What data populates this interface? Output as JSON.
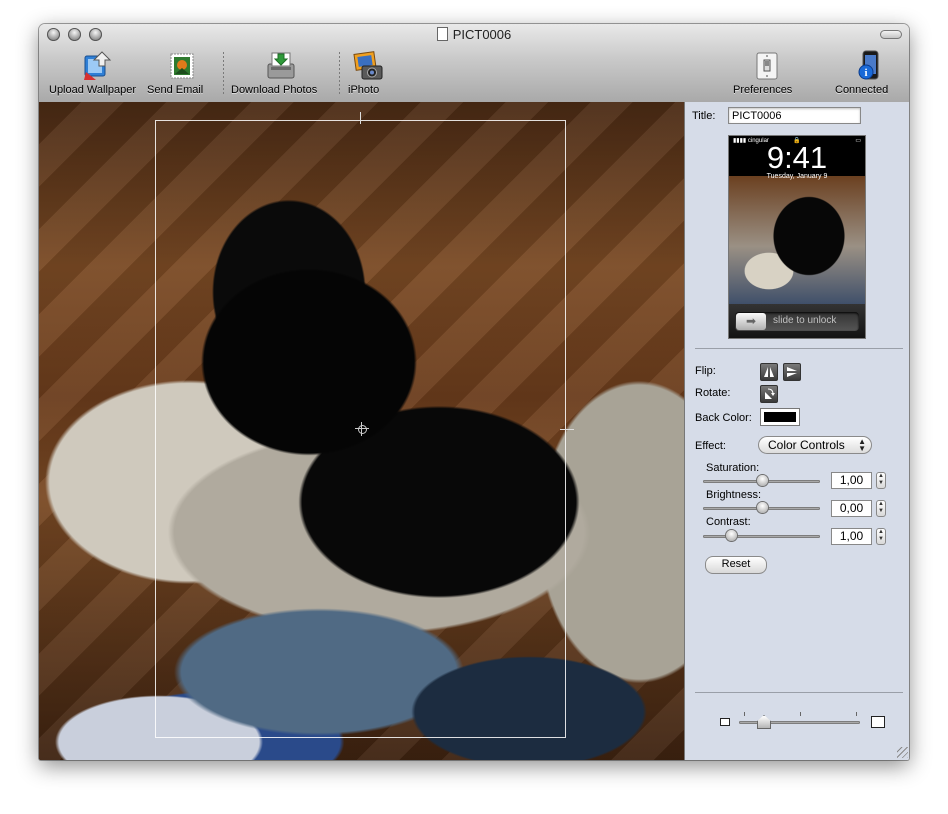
{
  "window": {
    "title": "PICT0006"
  },
  "toolbar": {
    "upload_wallpaper": "Upload Wallpaper",
    "send_email": "Send Email",
    "download_photos": "Download Photos",
    "iphoto": "iPhoto",
    "preferences": "Preferences",
    "connected": "Connected"
  },
  "panel": {
    "title_label": "Title:",
    "title_value": "PICT0006",
    "preview": {
      "carrier": "cingular",
      "time": "9:41",
      "date": "Tuesday, January 9",
      "unlock_text": "slide to unlock",
      "unlock_arrow": "➡"
    },
    "flip_label": "Flip:",
    "rotate_label": "Rotate:",
    "back_color_label": "Back Color:",
    "back_color": "#000000",
    "effect_label": "Effect:",
    "effect_value": "Color Controls",
    "saturation_label": "Saturation:",
    "saturation_value": "1,00",
    "brightness_label": "Brightness:",
    "brightness_value": "0,00",
    "contrast_label": "Contrast:",
    "contrast_value": "1,00",
    "reset_label": "Reset"
  },
  "icons": {
    "flip_horizontal": "flip-horizontal-icon",
    "flip_vertical": "flip-vertical-icon",
    "rotate": "rotate-icon"
  }
}
